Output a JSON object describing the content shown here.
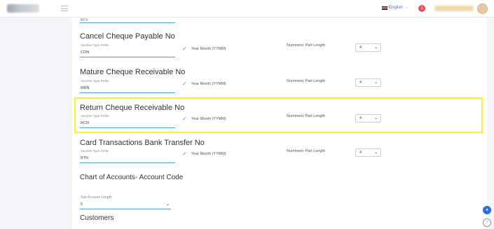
{
  "header": {
    "language": "English",
    "notification_count": "1",
    "icons": {
      "menu": "hamburger-icon",
      "bell": "bell-icon",
      "flag": "uk-flag-icon"
    }
  },
  "previous_field": {
    "value": "RCV"
  },
  "sections": [
    {
      "title": "Cancel Cheque Payable No",
      "prefix_label": "Voucher Type Prefix",
      "prefix_value": "CON",
      "year_month": "Year Month (YYMM)",
      "npl_label": "Nummeric Part Length",
      "npl_value": "4"
    },
    {
      "title": "Mature Cheque Receivable No",
      "prefix_label": "Voucher Type Prefix",
      "prefix_value": "MRN",
      "year_month": "Year Month (YYMM)",
      "npl_label": "Nummeric Part Length",
      "npl_value": "4"
    },
    {
      "title": "Return Cheque Receivable No",
      "prefix_label": "Voucher Type Prefix",
      "prefix_value": "RCN",
      "year_month": "Year Month (YYMM)",
      "npl_label": "Nummeric Part Length",
      "npl_value": "4"
    },
    {
      "title": "Card Transactions Bank Transfer No",
      "prefix_label": "Voucher Type Prefix",
      "prefix_value": "BTN",
      "year_month": "Year Month (YYMM)",
      "npl_label": "Nummeric Part Length",
      "npl_value": "4"
    }
  ],
  "chart_of_accounts": {
    "title": "Chart of Accounts- Account Code",
    "sub_account_label": "Sub Account Length",
    "sub_account_value": "5"
  },
  "customers": {
    "title": "Customers"
  },
  "colors": {
    "accent": "#4aa3c9",
    "highlight": "#f2f23a",
    "badge": "#e8505b"
  }
}
